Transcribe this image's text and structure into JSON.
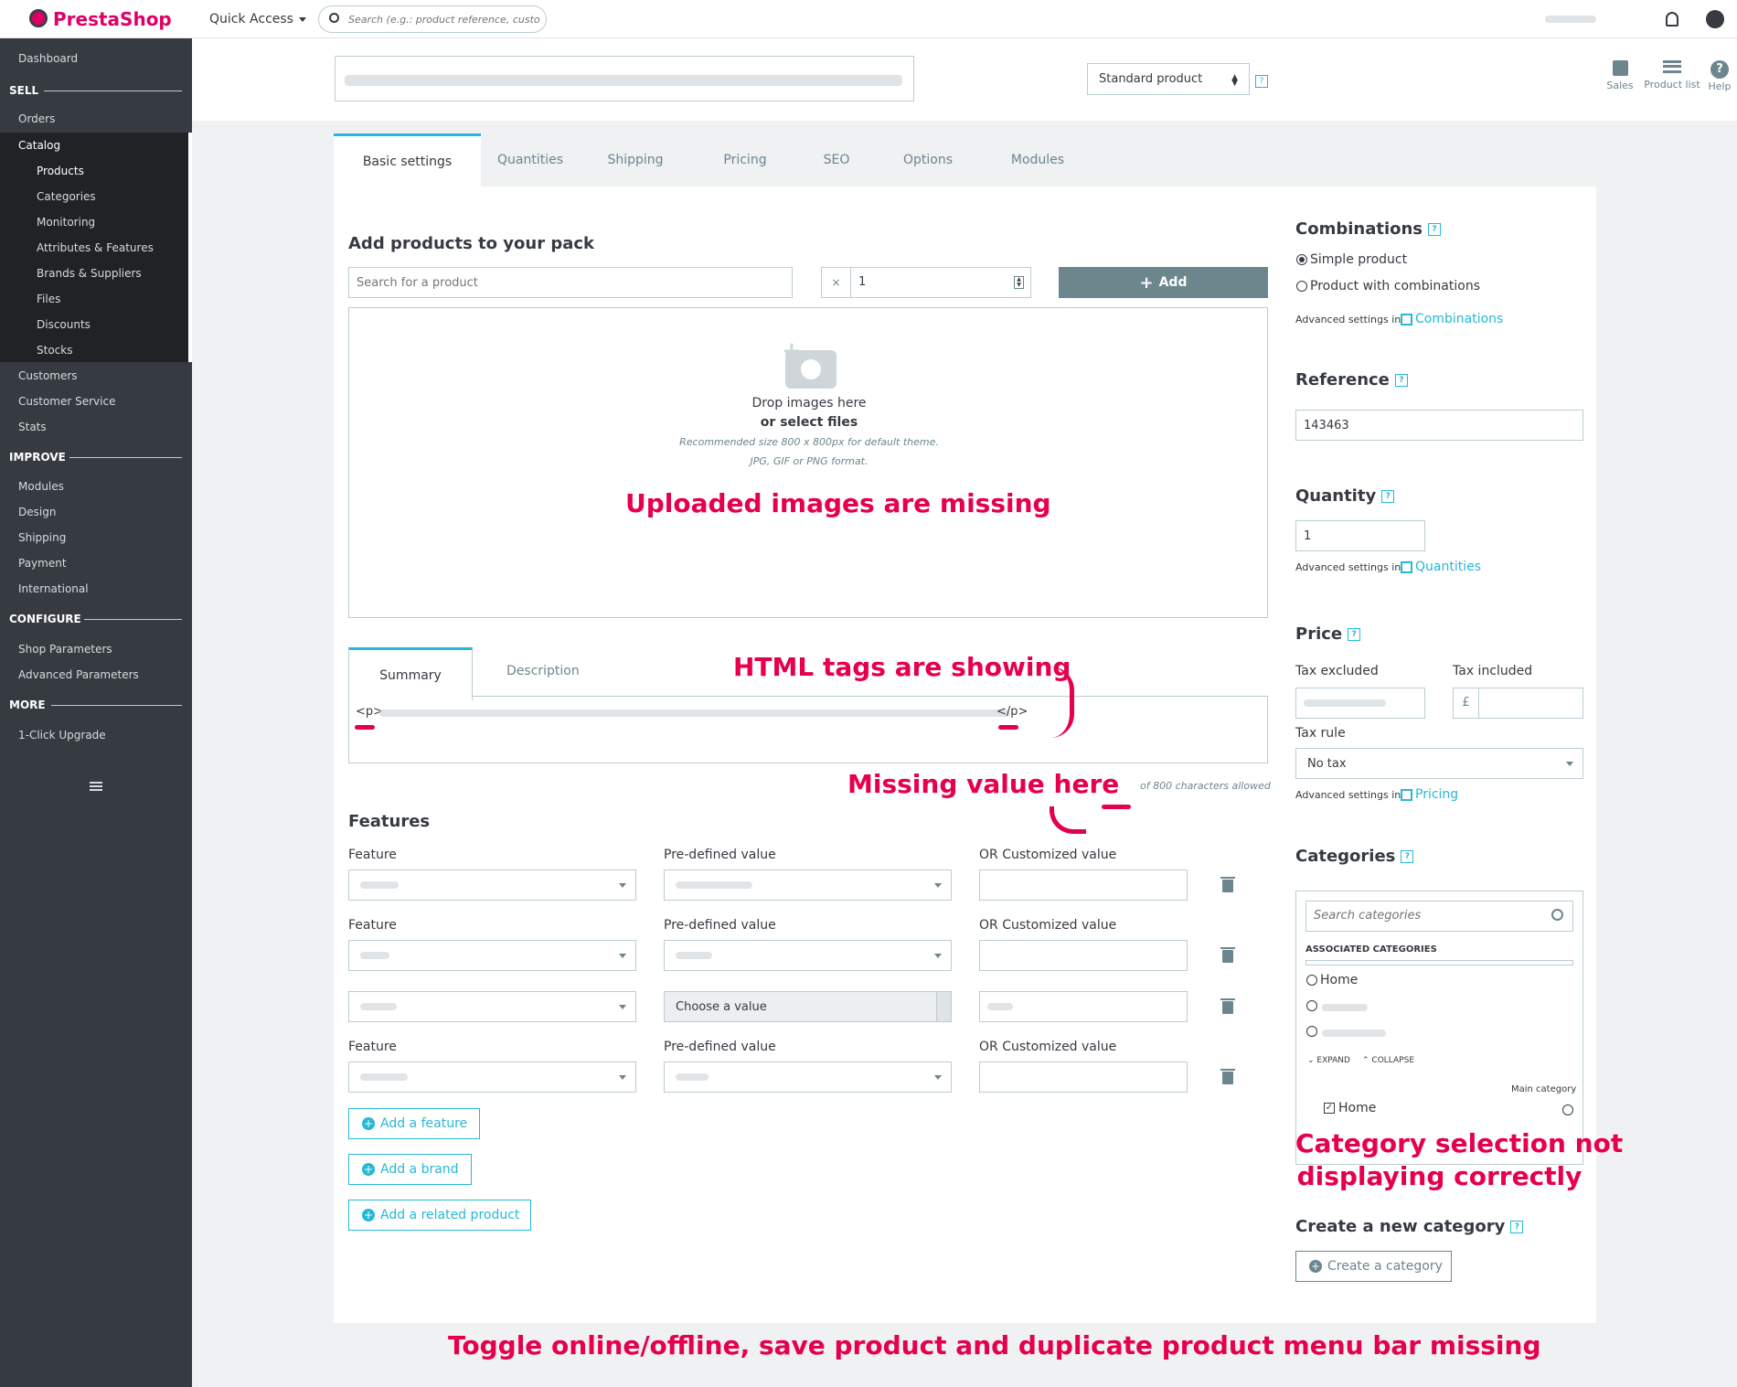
{
  "topbar": {
    "logo": "PrestaShop",
    "quick_access": "Quick Access",
    "search_placeholder": "Search (e.g.: product reference, custome"
  },
  "sidebar": {
    "dashboard": "Dashboard",
    "sell": "SELL",
    "orders": "Orders",
    "catalog": "Catalog",
    "catalog_items": [
      "Products",
      "Categories",
      "Monitoring",
      "Attributes & Features",
      "Brands & Suppliers",
      "Files",
      "Discounts",
      "Stocks"
    ],
    "customers": "Customers",
    "customer_service": "Customer Service",
    "stats": "Stats",
    "improve": "IMPROVE",
    "improve_items": [
      "Modules",
      "Design",
      "Shipping",
      "Payment",
      "International"
    ],
    "configure": "CONFIGURE",
    "configure_items": [
      "Shop Parameters",
      "Advanced Parameters"
    ],
    "more": "MORE",
    "more_items": [
      "1-Click Upgrade"
    ]
  },
  "header": {
    "product_type": "Standard product",
    "actions": [
      "Sales",
      "Product list",
      "Help"
    ]
  },
  "tabs": [
    "Basic settings",
    "Quantities",
    "Shipping",
    "Pricing",
    "SEO",
    "Options",
    "Modules"
  ],
  "pack": {
    "title": "Add products to your pack",
    "search_placeholder": "Search for a product",
    "qty_prefix": "×",
    "qty": "1",
    "add": "Add"
  },
  "dropzone": {
    "line1": "Drop images here",
    "line2": "or select files",
    "hint1": "Recommended size 800 x 800px for default theme.",
    "hint2": "JPG, GIF or PNG format."
  },
  "summary": {
    "tabs": [
      "Summary",
      "Description"
    ],
    "open_tag": "<p>",
    "close_tag": "</p>",
    "counter": "of 800 characters allowed"
  },
  "features": {
    "title": "Features",
    "feature_label": "Feature",
    "predef_label": "Pre-defined value",
    "custom_label": "OR Customized value",
    "choose": "Choose a value",
    "add_feature": "Add a feature",
    "add_brand": "Add a brand",
    "add_related": "Add a related product"
  },
  "right": {
    "combinations": "Combinations",
    "simple": "Simple product",
    "with_comb": "Product with combinations",
    "adv_in": "Advanced settings in",
    "comb_link": "Combinations",
    "reference": "Reference",
    "reference_val": "143463",
    "quantity": "Quantity",
    "quantity_val": "1",
    "qty_link": "Quantities",
    "price": "Price",
    "tax_excl": "Tax excluded",
    "tax_incl": "Tax included",
    "currency": "£",
    "tax_rule": "Tax rule",
    "tax_rule_val": "No tax",
    "price_link": "Pricing",
    "categories": "Categories",
    "cat_search": "Search categories",
    "assoc": "ASSOCIATED CATEGORIES",
    "home": "Home",
    "expand": "EXPAND",
    "collapse": "COLLAPSE",
    "main_cat": "Main category",
    "home2": "Home",
    "create_title": "Create a new category",
    "create_btn": "Create a category"
  },
  "annotations": {
    "images": "Uploaded images are missing",
    "html": "HTML tags are showing",
    "missing": "Missing value here",
    "category1": "Category selection not",
    "category2": "displaying correctly",
    "toolbar": "Toggle online/offline, save product and duplicate product menu bar missing"
  },
  "colors": {
    "accent": "#25b9d7",
    "sidebar": "#363a41",
    "annotation": "#e6004c",
    "add_button": "#6c868e"
  }
}
